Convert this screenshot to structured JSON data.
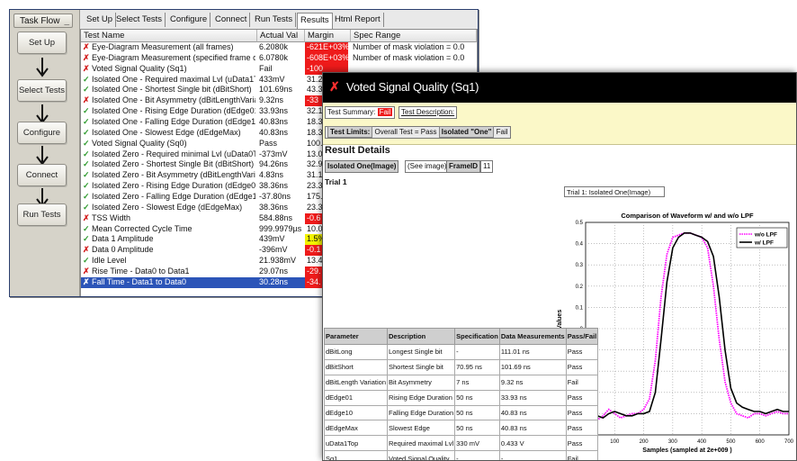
{
  "task_flow": {
    "title": "Task Flow",
    "steps": [
      "Set Up",
      "Select Tests",
      "Configure",
      "Connect",
      "Run Tests"
    ]
  },
  "tabs": [
    "Set Up",
    "Select Tests",
    "Configure",
    "Connect",
    "Run Tests",
    "Results",
    "Html Report"
  ],
  "active_tab": "Results",
  "results": {
    "columns": [
      "Test Name",
      "Actual Val",
      "Margin",
      "Spec Range"
    ],
    "rows": [
      {
        "status": "fail",
        "name": "Eye-Diagram Measurement (all frames)",
        "actual": "6.2080k",
        "margin": "-621E+03%",
        "spec": "Number of mask violation = 0.0",
        "mcolor": "#ee1b1b"
      },
      {
        "status": "fail",
        "name": "Eye-Diagram Measurement (specified frame only)",
        "actual": "6.0780k",
        "margin": "-608E+03%",
        "spec": "Number of mask violation = 0.0",
        "mcolor": "#ee1b1b"
      },
      {
        "status": "fail",
        "name": "Voted Signal Quality (Sq1)",
        "actual": "Fail",
        "margin": "-100",
        "spec": "",
        "mcolor": "#ee1b1b"
      },
      {
        "status": "pass",
        "name": "Isolated One - Required maximal Lvl (uData1Top)",
        "actual": "433mV",
        "margin": "31.2",
        "spec": "",
        "mcolor": ""
      },
      {
        "status": "pass",
        "name": "Isolated One - Shortest Single bit (dBitShort)",
        "actual": "101.69ns",
        "margin": "43.3",
        "spec": "",
        "mcolor": ""
      },
      {
        "status": "fail",
        "name": "Isolated One - Bit Asymmetry (dBitLengthVariation)",
        "actual": "9.32ns",
        "margin": "-33",
        "spec": "",
        "mcolor": "#ee1b1b"
      },
      {
        "status": "pass",
        "name": "Isolated One - Rising Edge Duration (dEdge01)",
        "actual": "33.93ns",
        "margin": "32.1",
        "spec": "",
        "mcolor": ""
      },
      {
        "status": "pass",
        "name": "Isolated One - Falling Edge Duration (dEdge10)",
        "actual": "40.83ns",
        "margin": "18.3",
        "spec": "",
        "mcolor": ""
      },
      {
        "status": "pass",
        "name": "Isolated One - Slowest Edge (dEdgeMax)",
        "actual": "40.83ns",
        "margin": "18.3",
        "spec": "",
        "mcolor": ""
      },
      {
        "status": "pass",
        "name": "Voted Signal Quality (Sq0)",
        "actual": "Pass",
        "margin": "100.",
        "spec": "",
        "mcolor": ""
      },
      {
        "status": "pass",
        "name": "Isolated Zero - Required minimal Lvl (uData0Top)",
        "actual": "-373mV",
        "margin": "13.0",
        "spec": "",
        "mcolor": ""
      },
      {
        "status": "pass",
        "name": "Isolated Zero - Shortest Single Bit (dBitShort)",
        "actual": "94.26ns",
        "margin": "32.9",
        "spec": "",
        "mcolor": ""
      },
      {
        "status": "pass",
        "name": "Isolated Zero - Bit Asymmetry (dBitLengthVariation)",
        "actual": "4.83ns",
        "margin": "31.1",
        "spec": "",
        "mcolor": ""
      },
      {
        "status": "pass",
        "name": "Isolated Zero - Rising Edge Duration (dEdge01)",
        "actual": "38.36ns",
        "margin": "23.3",
        "spec": "",
        "mcolor": ""
      },
      {
        "status": "pass",
        "name": "Isolated Zero - Falling Edge Duration (dEdge10)",
        "actual": "-37.80ns",
        "margin": "175.",
        "spec": "",
        "mcolor": ""
      },
      {
        "status": "pass",
        "name": "Isolated Zero - Slowest Edge (dEdgeMax)",
        "actual": "38.36ns",
        "margin": "23.3",
        "spec": "",
        "mcolor": ""
      },
      {
        "status": "fail",
        "name": "TSS Width",
        "actual": "584.88ns",
        "margin": "-0.6",
        "spec": "",
        "mcolor": "#ee1b1b"
      },
      {
        "status": "pass",
        "name": "Mean Corrected Cycle Time",
        "actual": "999.9979µs",
        "margin": "10.0",
        "spec": "",
        "mcolor": ""
      },
      {
        "status": "pass",
        "name": "Data 1 Amplitude",
        "actual": "439mV",
        "margin": "1.5%",
        "spec": "",
        "mcolor": "#f2f200"
      },
      {
        "status": "fail",
        "name": "Data 0 Amplitude",
        "actual": "-396mV",
        "margin": "-0.1",
        "spec": "",
        "mcolor": "#ee1b1b"
      },
      {
        "status": "pass",
        "name": "Idle Level",
        "actual": "21.938mV",
        "margin": "13.4",
        "spec": "",
        "mcolor": ""
      },
      {
        "status": "fail",
        "name": "Rise Time - Data0 to Data1",
        "actual": "29.07ns",
        "margin": "-29.",
        "spec": "",
        "mcolor": "#ee1b1b"
      },
      {
        "status": "fail",
        "name": "Fall Time - Data1 to Data0",
        "actual": "30.28ns",
        "margin": "-34.",
        "spec": "",
        "mcolor": "#ee1b1b",
        "selected": true
      }
    ]
  },
  "report": {
    "title": "Voted Signal Quality (Sq1)",
    "summary_label": "Test Summary:",
    "summary_status": "Fail",
    "description_label": "Test Description:",
    "limits_label": "Test Limits:",
    "limits_value": "Overall Test = Pass",
    "isolated_label": "Isolated \"One\"",
    "isolated_value": "Fail",
    "result_details": "Result Details",
    "image_tag": "Isolated One(Image)",
    "see_image": "(See image)",
    "frame_label": "FrameID",
    "frame_value": "11",
    "trial": "Trial 1",
    "chart_caption": "Trial 1: Isolated One(Image)",
    "params": {
      "headers": [
        "Parameter",
        "Description",
        "Specification",
        "Data Measurements",
        "Pass/Fail"
      ],
      "rows": [
        [
          "dBitLong",
          "Longest Single bit",
          "-",
          "111.01 ns",
          "Pass"
        ],
        [
          "dBitShort",
          "Shortest Single bit",
          "70.95 ns",
          "101.69 ns",
          "Pass"
        ],
        [
          "dBitLength Variation",
          "Bit Asymmetry",
          "7 ns",
          "9.32 ns",
          "Fail"
        ],
        [
          "dEdge01",
          "Rising Edge Duration",
          "50 ns",
          "33.93 ns",
          "Pass"
        ],
        [
          "dEdge10",
          "Falling Edge Duration",
          "50 ns",
          "40.83 ns",
          "Pass"
        ],
        [
          "dEdgeMax",
          "Slowest Edge",
          "50 ns",
          "40.83 ns",
          "Pass"
        ],
        [
          "uData1Top",
          "Required maximal Lvl",
          "330 mV",
          "0.433 V",
          "Pass"
        ],
        [
          "Sq1",
          "Voted Signal Quality",
          "-",
          "-",
          "Fail"
        ]
      ]
    }
  },
  "chart_data": {
    "type": "line",
    "title": "Comparison of Waveform w/ and w/o LPF",
    "xlabel": "Samples (sampled at 2e+009 )",
    "ylabel": "Trace Values",
    "xlim": [
      0,
      700
    ],
    "ylim": [
      -0.5,
      0.5
    ],
    "xticks": [
      0,
      100,
      200,
      300,
      400,
      500,
      600,
      700
    ],
    "yticks": [
      -0.5,
      -0.4,
      -0.3,
      -0.2,
      -0.1,
      0,
      0.1,
      0.2,
      0.3,
      0.4,
      0.5
    ],
    "grid": true,
    "legend_position": "top-right",
    "series": [
      {
        "name": "w/o LPF",
        "color": "#ff00ff",
        "style": "dotted",
        "x": [
          0,
          20,
          40,
          60,
          80,
          100,
          120,
          140,
          160,
          180,
          200,
          220,
          240,
          260,
          280,
          300,
          320,
          340,
          360,
          380,
          400,
          420,
          440,
          460,
          480,
          500,
          520,
          540,
          560,
          580,
          600,
          620,
          640,
          660,
          680,
          700
        ],
        "y": [
          -0.38,
          -0.42,
          -0.43,
          -0.41,
          -0.38,
          -0.4,
          -0.42,
          -0.41,
          -0.4,
          -0.4,
          -0.38,
          -0.33,
          -0.15,
          0.15,
          0.35,
          0.43,
          0.44,
          0.45,
          0.45,
          0.44,
          0.43,
          0.38,
          0.2,
          -0.05,
          -0.25,
          -0.35,
          -0.4,
          -0.41,
          -0.42,
          -0.4,
          -0.4,
          -0.41,
          -0.4,
          -0.39,
          -0.4,
          -0.4
        ]
      },
      {
        "name": "w/ LPF",
        "color": "#000000",
        "style": "solid",
        "x": [
          0,
          20,
          40,
          60,
          80,
          100,
          120,
          140,
          160,
          180,
          200,
          220,
          240,
          260,
          280,
          300,
          320,
          340,
          360,
          380,
          400,
          420,
          440,
          460,
          480,
          500,
          520,
          540,
          560,
          580,
          600,
          620,
          640,
          660,
          680,
          700
        ],
        "y": [
          -0.36,
          -0.38,
          -0.41,
          -0.42,
          -0.4,
          -0.39,
          -0.4,
          -0.41,
          -0.41,
          -0.4,
          -0.4,
          -0.39,
          -0.3,
          -0.05,
          0.22,
          0.38,
          0.43,
          0.45,
          0.45,
          0.44,
          0.43,
          0.41,
          0.34,
          0.15,
          -0.1,
          -0.28,
          -0.35,
          -0.37,
          -0.38,
          -0.39,
          -0.39,
          -0.4,
          -0.39,
          -0.38,
          -0.39,
          -0.39
        ]
      }
    ]
  }
}
